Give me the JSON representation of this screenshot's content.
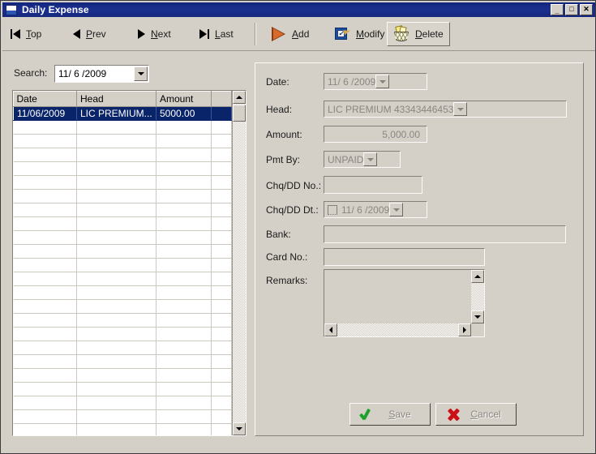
{
  "window": {
    "title": "Daily Expense",
    "icon": "window-app-icon",
    "controls": {
      "minimize": "_",
      "maximize": "□",
      "close": "✕"
    }
  },
  "toolbar": {
    "nav": [
      {
        "name": "top",
        "label": "Top",
        "accel": "T",
        "icon": "first-record-icon"
      },
      {
        "name": "prev",
        "label": "Prev",
        "accel": "P",
        "icon": "previous-record-icon"
      },
      {
        "name": "next",
        "label": "Next",
        "accel": "N",
        "icon": "next-record-icon"
      },
      {
        "name": "last",
        "label": "Last",
        "accel": "L",
        "icon": "last-record-icon"
      }
    ],
    "actions": [
      {
        "name": "add",
        "label": "Add",
        "accel": "A",
        "icon": "add-arrow-icon",
        "pressed": false
      },
      {
        "name": "modify",
        "label": "Modify",
        "accel": "M",
        "icon": "modify-edit-icon",
        "pressed": false
      },
      {
        "name": "delete",
        "label": "Delete",
        "accel": "D",
        "icon": "delete-trash-icon",
        "pressed": true
      }
    ]
  },
  "search": {
    "label": "Search:",
    "value": "11/ 6 /2009",
    "dropdown_icon": "chevron-down-icon"
  },
  "grid": {
    "columns": [
      "Date",
      "Head",
      "Amount",
      ""
    ],
    "rows": [
      {
        "date": "11/06/2009",
        "head": "LIC PREMIUM...",
        "amount": "5000.00",
        "pad": "",
        "selected": true
      }
    ],
    "empty_row_count": 24,
    "scrollbar": {
      "up_icon": "scroll-up-icon",
      "down_icon": "scroll-down-icon"
    }
  },
  "form": {
    "fields": [
      {
        "name": "date",
        "label": "Date:",
        "value": "11/ 6 /2009",
        "type": "date-combo",
        "disabled": true
      },
      {
        "name": "head",
        "label": "Head:",
        "value": "LIC PREMIUM 43343446453",
        "type": "combo",
        "disabled": true
      },
      {
        "name": "amount",
        "label": "Amount:",
        "value": "5,000.00",
        "type": "text-right",
        "disabled": true
      },
      {
        "name": "pmt-by",
        "label": "Pmt By:",
        "value": "UNPAID",
        "type": "combo",
        "disabled": true
      },
      {
        "name": "chq-dd-no",
        "label": "Chq/DD No.:",
        "value": "",
        "type": "text",
        "disabled": true
      },
      {
        "name": "chq-dd-dt",
        "label": "Chq/DD Dt.:",
        "value": "11/ 6 /2009",
        "type": "check-date",
        "disabled": true
      },
      {
        "name": "bank",
        "label": "Bank:",
        "value": "",
        "type": "text",
        "disabled": true
      },
      {
        "name": "card-no",
        "label": "Card No.:",
        "value": "",
        "type": "text",
        "disabled": true
      },
      {
        "name": "remarks",
        "label": "Remarks:",
        "value": "",
        "type": "textarea",
        "disabled": true
      }
    ],
    "buttons": [
      {
        "name": "save",
        "label": "Save",
        "accel": "S",
        "icon": "green-check-icon",
        "disabled": true
      },
      {
        "name": "cancel",
        "label": "Cancel",
        "accel": "C",
        "icon": "red-x-icon",
        "disabled": true
      }
    ]
  },
  "colors": {
    "face": "#d4d0c8",
    "title_bar": "#16287d",
    "selection": "#0a246a",
    "disabled_text": "#8a8680",
    "add_icon": "#d96b2a",
    "modify_icon": "#1a4fa0",
    "save_icon": "#1fa02a",
    "cancel_icon": "#cc0f16"
  }
}
